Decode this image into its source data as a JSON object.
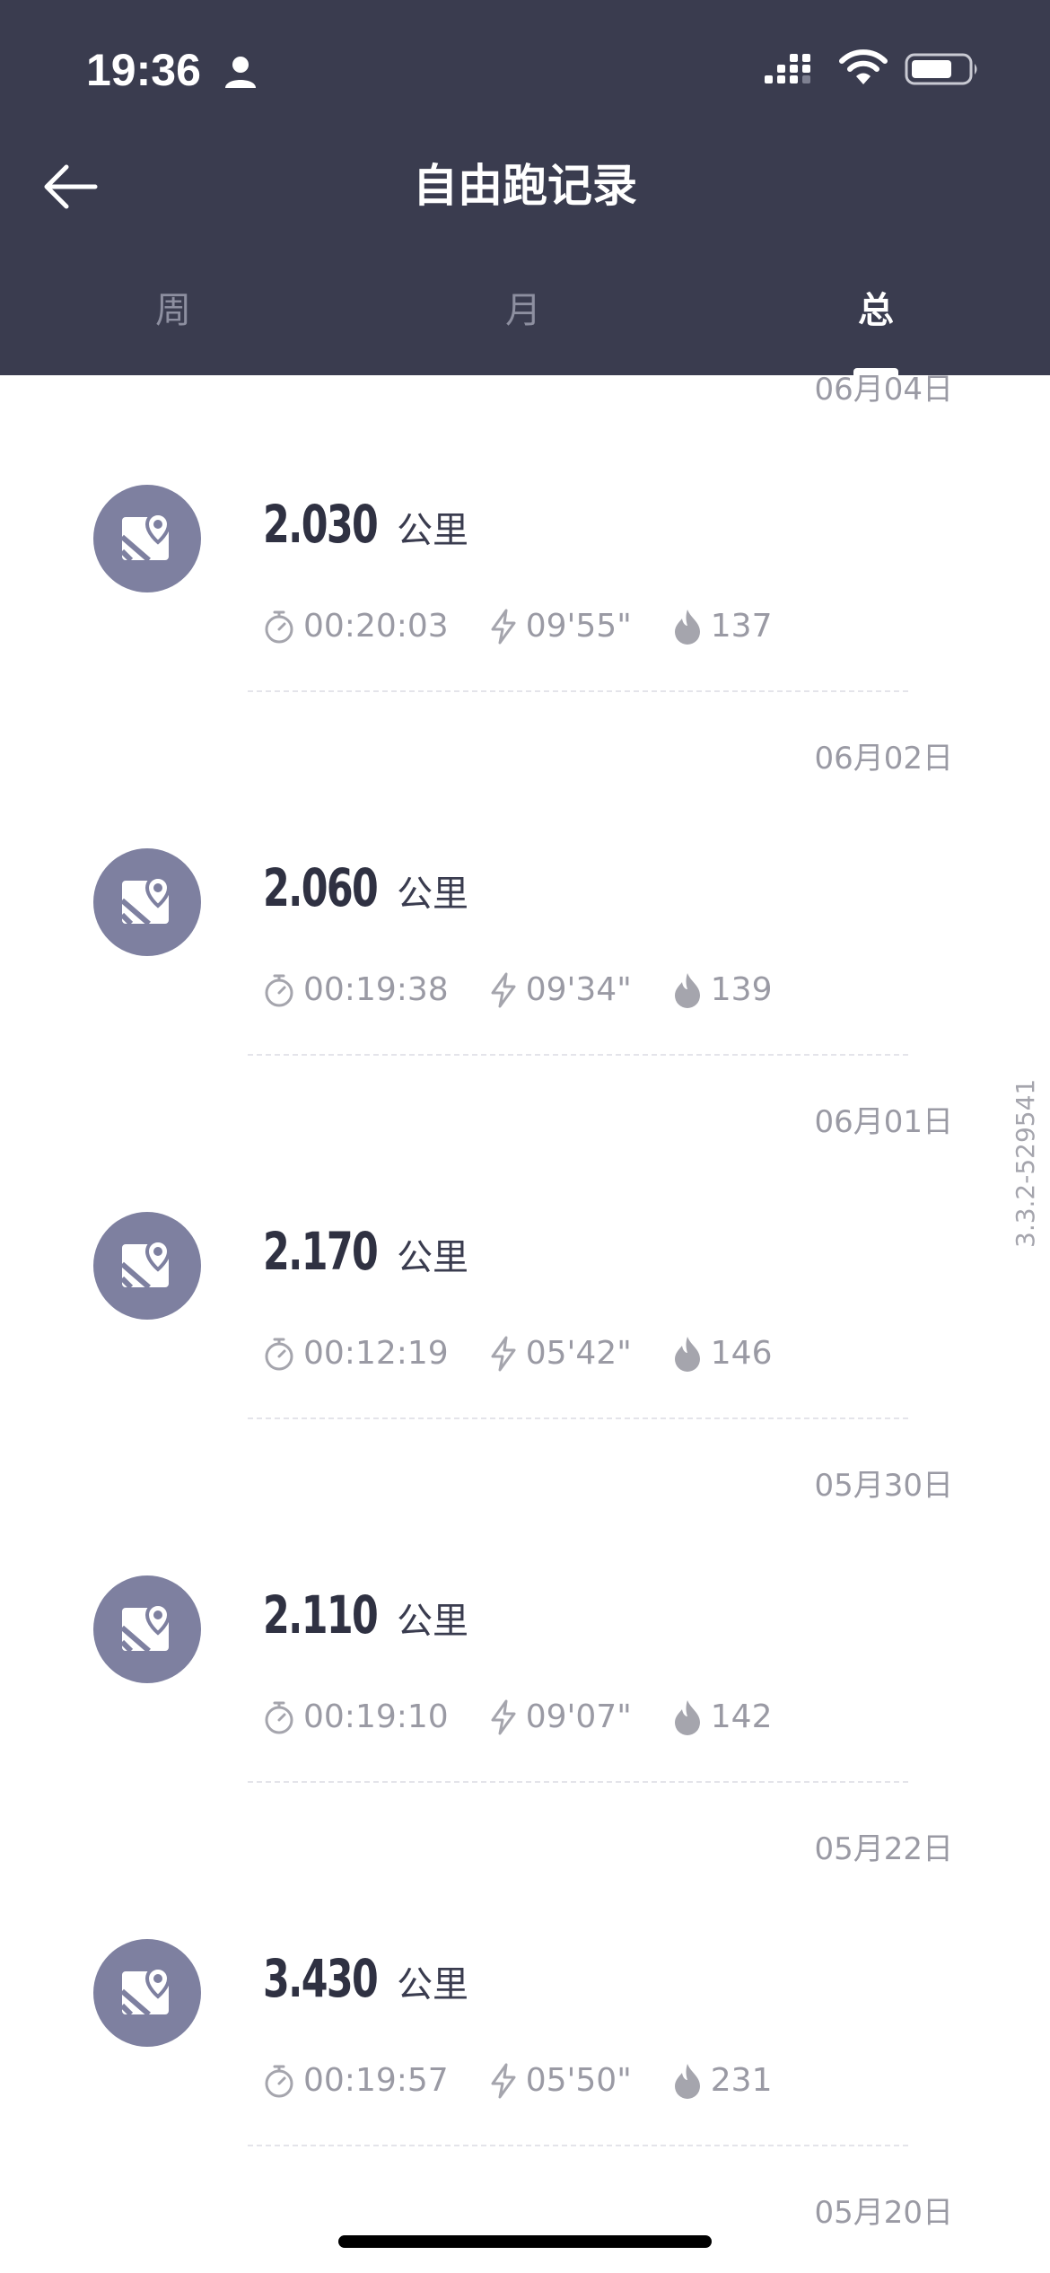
{
  "status_bar": {
    "time": "19:36"
  },
  "header": {
    "title": "自由跑记录"
  },
  "tabs": [
    {
      "label": "周",
      "active": false
    },
    {
      "label": "月",
      "active": false
    },
    {
      "label": "总",
      "active": true
    }
  ],
  "records": [
    {
      "date": "06月04日",
      "distance": "2.030",
      "unit": "公里",
      "duration": "00:20:03",
      "pace": "09'55\"",
      "calories": "137"
    },
    {
      "date": "06月02日",
      "distance": "2.060",
      "unit": "公里",
      "duration": "00:19:38",
      "pace": "09'34\"",
      "calories": "139"
    },
    {
      "date": "06月01日",
      "distance": "2.170",
      "unit": "公里",
      "duration": "00:12:19",
      "pace": "05'42\"",
      "calories": "146"
    },
    {
      "date": "05月30日",
      "distance": "2.110",
      "unit": "公里",
      "duration": "00:19:10",
      "pace": "09'07\"",
      "calories": "142"
    },
    {
      "date": "05月22日",
      "distance": "3.430",
      "unit": "公里",
      "duration": "00:19:57",
      "pace": "05'50\"",
      "calories": "231"
    }
  ],
  "next_date": "05月20日",
  "version": "3.3.2-529541",
  "colors": {
    "header_bg": "#3a3c4f",
    "avatar_bg": "#7e80a0",
    "secondary_text": "#9a9aa4"
  }
}
